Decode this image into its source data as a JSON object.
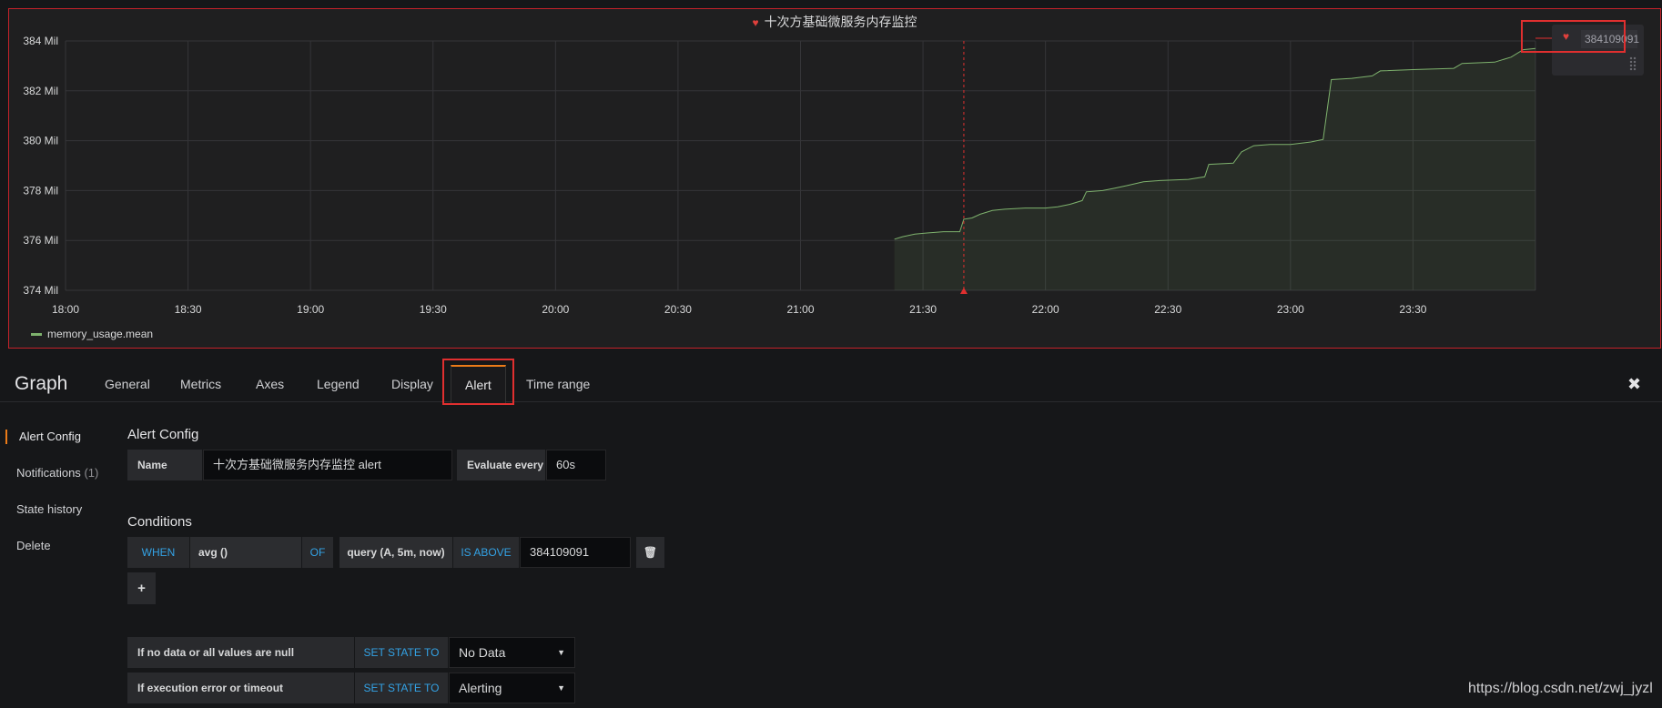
{
  "panel": {
    "title": "十次方基础微服务内存监控",
    "legend_label": "memory_usage.mean",
    "threshold_value": "384109091",
    "title_icon": "heart-broken-icon"
  },
  "chart_data": {
    "type": "line",
    "title": "十次方基础微服务内存监控",
    "xlabel": "",
    "ylabel": "",
    "x_ticks": [
      "18:00",
      "18:30",
      "19:00",
      "19:30",
      "20:00",
      "20:30",
      "21:00",
      "21:30",
      "22:00",
      "22:30",
      "23:00",
      "23:30"
    ],
    "y_ticks": [
      "374 Mil",
      "376 Mil",
      "378 Mil",
      "380 Mil",
      "382 Mil",
      "384 Mil"
    ],
    "ylim": [
      374,
      384
    ],
    "xlim": [
      "18:00",
      "24:00"
    ],
    "y_unit": "Mil",
    "grid": true,
    "fill": true,
    "legend_position": "bottom-left",
    "threshold": 384.109091,
    "alert_marker_time": "21:40",
    "series": [
      {
        "name": "memory_usage.mean",
        "color": "#7eb26d",
        "points": [
          [
            "21:23",
            376.05
          ],
          [
            "21:25",
            376.15
          ],
          [
            "21:28",
            376.25
          ],
          [
            "21:31",
            376.3
          ],
          [
            "21:35",
            376.35
          ],
          [
            "21:39",
            376.35
          ],
          [
            "21:40",
            376.85
          ],
          [
            "21:42",
            376.9
          ],
          [
            "21:44",
            377.05
          ],
          [
            "21:47",
            377.2
          ],
          [
            "21:50",
            377.25
          ],
          [
            "21:55",
            377.3
          ],
          [
            "22:00",
            377.3
          ],
          [
            "22:03",
            377.35
          ],
          [
            "22:06",
            377.45
          ],
          [
            "22:09",
            377.6
          ],
          [
            "22:10",
            377.95
          ],
          [
            "22:14",
            378.0
          ],
          [
            "22:17",
            378.1
          ],
          [
            "22:20",
            378.2
          ],
          [
            "22:24",
            378.35
          ],
          [
            "22:28",
            378.4
          ],
          [
            "22:35",
            378.45
          ],
          [
            "22:39",
            378.55
          ],
          [
            "22:40",
            379.05
          ],
          [
            "22:46",
            379.1
          ],
          [
            "22:48",
            379.55
          ],
          [
            "22:51",
            379.8
          ],
          [
            "22:55",
            379.85
          ],
          [
            "23:00",
            379.85
          ],
          [
            "23:05",
            379.95
          ],
          [
            "23:08",
            380.05
          ],
          [
            "23:10",
            382.45
          ],
          [
            "23:15",
            382.5
          ],
          [
            "23:20",
            382.6
          ],
          [
            "23:22",
            382.8
          ],
          [
            "23:30",
            382.85
          ],
          [
            "23:40",
            382.9
          ],
          [
            "23:42",
            383.1
          ],
          [
            "23:50",
            383.15
          ],
          [
            "23:54",
            383.35
          ],
          [
            "23:57",
            383.65
          ],
          [
            "24:00",
            383.7
          ]
        ]
      }
    ]
  },
  "editor": {
    "title": "Graph",
    "tabs": [
      "General",
      "Metrics",
      "Axes",
      "Legend",
      "Display",
      "Alert",
      "Time range"
    ],
    "active_tab": "Alert",
    "sidebar": {
      "items": [
        "Alert Config",
        "Notifications",
        "State history",
        "Delete"
      ],
      "notifications_count": "(1)"
    },
    "alert_config": {
      "section_title": "Alert Config",
      "name_label": "Name",
      "name_value": "十次方基础微服务内存监控 alert",
      "evaluate_label": "Evaluate every",
      "evaluate_value": "60s"
    },
    "conditions": {
      "section_title": "Conditions",
      "when": "WHEN",
      "reducer": "avg ()",
      "of": "OF",
      "query": "query (A, 5m, now)",
      "evaluator": "IS ABOVE",
      "threshold": "384109091",
      "add_label": "+"
    },
    "no_data": {
      "label": "If no data or all values are null",
      "set_state": "SET STATE TO",
      "value": "No Data"
    },
    "exec_error": {
      "label": "If execution error or timeout",
      "set_state": "SET STATE TO",
      "value": "Alerting"
    }
  },
  "watermark": "https://blog.csdn.net/zwj_jyzl",
  "colors": {
    "accent": "#eb7b18",
    "series": "#7eb26d",
    "highlight": "#e02f2f",
    "keyword": "#33a2e5",
    "background": "#161719"
  }
}
